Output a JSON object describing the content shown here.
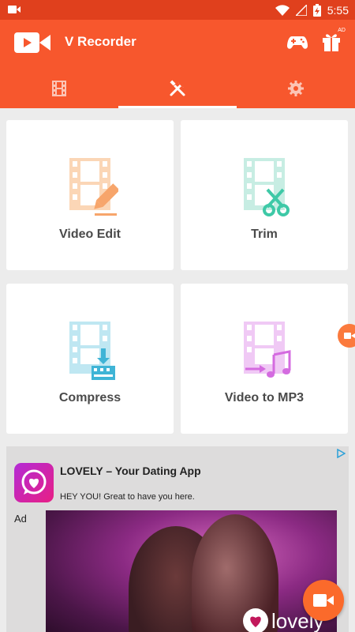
{
  "status_bar": {
    "time": "5:55",
    "left_icon": "video-recording-icon",
    "icons": [
      "wifi-icon",
      "signal-icon",
      "battery-charging-icon"
    ]
  },
  "app_bar": {
    "title": "V Recorder",
    "logo": "app-logo-icon",
    "actions": [
      "gamepad-icon",
      "gift-icon"
    ],
    "gift_badge": "AD"
  },
  "tabs": [
    {
      "name": "videos",
      "icon": "film-icon",
      "active": false
    },
    {
      "name": "tools",
      "icon": "tools-icon",
      "active": true
    },
    {
      "name": "settings",
      "icon": "gear-icon",
      "active": false
    }
  ],
  "tools": [
    {
      "label": "Video Edit",
      "icon": "video-edit-icon",
      "color": "#f7a56b"
    },
    {
      "label": "Trim",
      "icon": "trim-icon",
      "color": "#3ec9a7"
    },
    {
      "label": "Compress",
      "icon": "compress-icon",
      "color": "#3fb4d6"
    },
    {
      "label": "Video to MP3",
      "icon": "video-to-mp3-icon",
      "color": "#d46be0"
    }
  ],
  "ad": {
    "app_name": "LOVELY – Your Dating App",
    "tagline": "HEY YOU! Great to have you here.",
    "ad_label": "Ad",
    "brand_text": "lovely"
  },
  "colors": {
    "accent": "#f7572d",
    "status_bar": "#e0401d",
    "background": "#ececec",
    "fab": "#fb6a2b"
  }
}
